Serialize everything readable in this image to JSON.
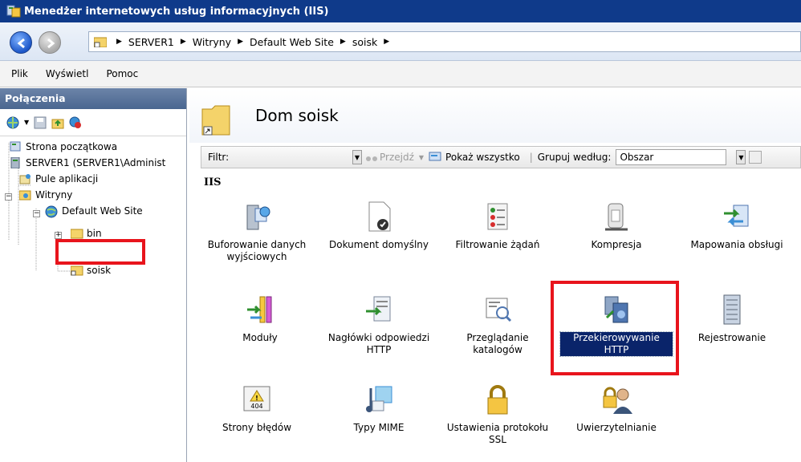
{
  "window": {
    "title": "Menedżer internetowych usług informacyjnych (IIS)"
  },
  "address": {
    "crumbs": [
      "SERVER1",
      "Witryny",
      "Default Web Site",
      "soisk"
    ]
  },
  "menu": {
    "items": [
      "Plik",
      "Wyświetl",
      "Pomoc"
    ]
  },
  "connections": {
    "title": "Połączenia",
    "tree": {
      "start_page": "Strona początkowa",
      "server": "SERVER1 (SERVER1\\Administ",
      "app_pools": "Pule aplikacji",
      "sites": "Witryny",
      "default_site": "Default Web Site",
      "bin": "bin",
      "soisk": "soisk"
    }
  },
  "content": {
    "title": "Dom soisk",
    "filter_label": "Filtr:",
    "go_label": "Przejdź",
    "show_all_label": "Pokaż wszystko",
    "group_by_label": "Grupuj według:",
    "group_by_value": "Obszar",
    "section": "IIS",
    "features": {
      "caching": "Buforowanie danych wyjściowych",
      "default_doc": "Dokument domyślny",
      "request_filtering": "Filtrowanie żądań",
      "compression": "Kompresja",
      "handler_mappings": "Mapowania obsługi",
      "modules": "Moduły",
      "http_headers": "Nagłówki odpowiedzi HTTP",
      "dir_browsing": "Przeglądanie katalogów",
      "http_redirect": "Przekierowywanie HTTP",
      "logging": "Rejestrowanie",
      "error_pages": "Strony błędów",
      "mime_types": "Typy MIME",
      "ssl_settings": "Ustawienia protokołu SSL",
      "authentication": "Uwierzytelnianie"
    },
    "error_badge": "404"
  },
  "colors": {
    "highlight": "#e8141c",
    "selection": "#0a246a",
    "titlebar": "#0f3a8a"
  }
}
